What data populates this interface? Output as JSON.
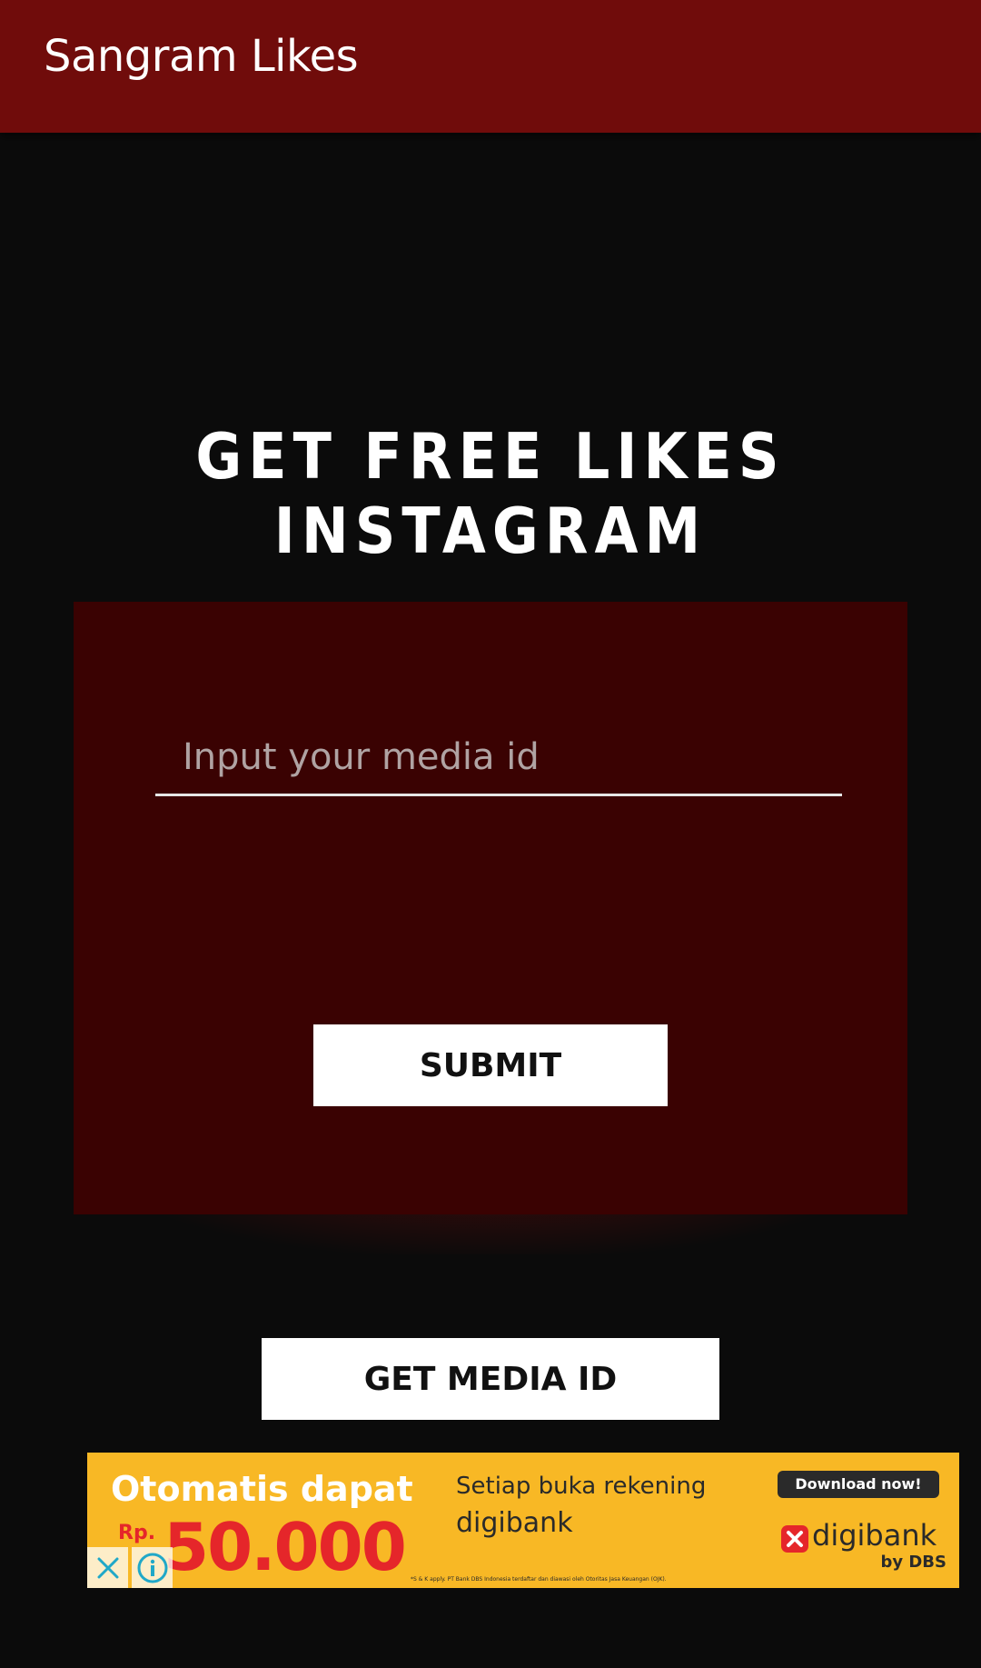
{
  "app": {
    "title": "Sangram Likes"
  },
  "main": {
    "headline": "GET FREE LIKES INSTAGRAM",
    "media_input": {
      "placeholder": "Input your media id",
      "value": ""
    },
    "submit_label": "SUBMIT",
    "get_media_id_label": "GET MEDIA ID"
  },
  "ad": {
    "headline": "Otomatis dapat",
    "currency": "Rp.",
    "amount": "50.000",
    "subtitle_line1": "Setiap buka rekening",
    "subtitle_line2": "digibank",
    "download_label": "Download now!",
    "brand_name": "digibank",
    "brand_by": "by DBS",
    "fine_print": "*S & K apply. PT Bank DBS Indonesia terdaftar dan diawasi oleh Otoritas Jasa Keuangan (OJK).",
    "close_icon": "close-icon",
    "info_icon": "info-icon"
  },
  "colors": {
    "appbar": "#700c0b",
    "background": "#0b0b0b",
    "card": "#3a0202",
    "ad_background": "#f8b825",
    "ad_amount": "#e5262a"
  }
}
